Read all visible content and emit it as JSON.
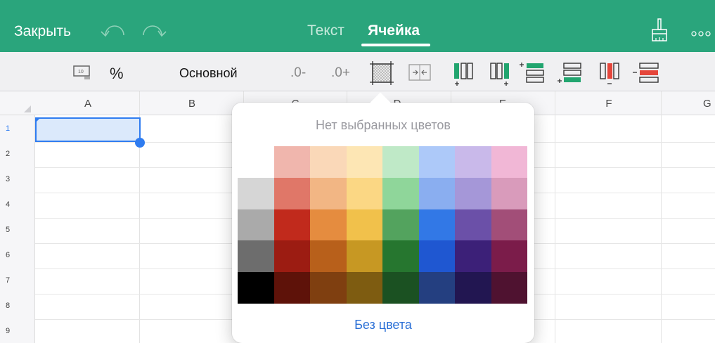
{
  "header": {
    "close_label": "Закрыть",
    "tabs": [
      {
        "label": "Текст",
        "active": false
      },
      {
        "label": "Ячейка",
        "active": true
      }
    ],
    "icons": [
      "undo-icon",
      "redo-icon",
      "paintbrush-icon",
      "more-icon"
    ]
  },
  "toolbar": {
    "percent_label": "%",
    "format_label": "Основной",
    "decrease_decimals_label": ".0-",
    "increase_decimals_label": ".0+"
  },
  "sheet": {
    "columns": [
      "A",
      "B",
      "C",
      "D",
      "E",
      "F",
      "G"
    ],
    "rows": [
      "1",
      "2",
      "3",
      "4",
      "5",
      "6",
      "7",
      "8",
      "9"
    ],
    "selected_cell": "A1"
  },
  "color_popover": {
    "title": "Нет выбранных цветов",
    "no_color_label": "Без цвета",
    "swatches": [
      [
        "#ffffff",
        "#f0b6ad",
        "#fad8b8",
        "#fde6b4",
        "#bfe9c7",
        "#adc9f9",
        "#c9b9ea",
        "#f1b7d6"
      ],
      [
        "#d6d6d6",
        "#e07768",
        "#f2b684",
        "#fbd784",
        "#8fd69a",
        "#8aaef0",
        "#a597d8",
        "#d99bbb"
      ],
      [
        "#aaaaaa",
        "#c12a1c",
        "#e58c3f",
        "#f1c14b",
        "#53a35e",
        "#3278e6",
        "#6b50a8",
        "#a24e78"
      ],
      [
        "#6d6d6d",
        "#9c1c12",
        "#b8601b",
        "#c79823",
        "#26762f",
        "#1f57d1",
        "#3c2078",
        "#7b1c4a"
      ],
      [
        "#000000",
        "#5e1209",
        "#7f3f10",
        "#7e5c11",
        "#1b5122",
        "#243f80",
        "#221651",
        "#4f1230"
      ]
    ]
  },
  "colors": {
    "accent_green": "#2aa57c",
    "selection_blue": "#2f7cf0",
    "link_blue": "#2a6fd6"
  }
}
